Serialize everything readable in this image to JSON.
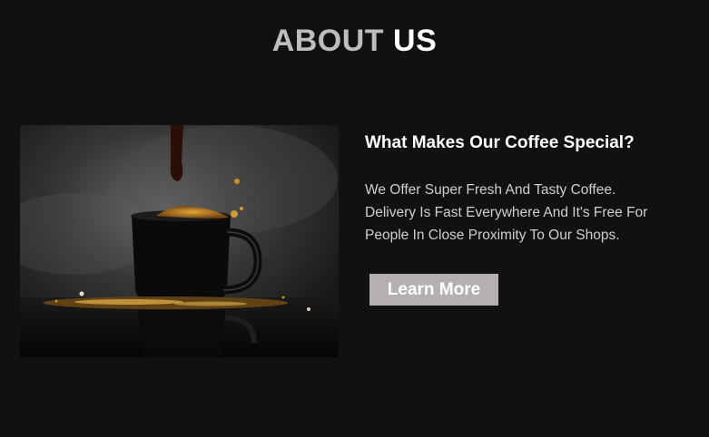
{
  "section": {
    "title_part1": "ABOUT",
    "title_part2": "US"
  },
  "about": {
    "subtitle": "What Makes Our Coffee Special?",
    "description_lines": [
      "We Offer Super Fresh And Tasty Coffee.",
      "Delivery Is Fast Everywhere And It's Free For",
      "People In Close Proximity To Our Shops."
    ],
    "cta_label": "Learn More"
  },
  "colors": {
    "background": "#111111",
    "title_muted": "#bdbdbd",
    "title_bright": "#ffffff",
    "button_bg": "#b5b0b0",
    "coffee_accent": "#c8902a"
  },
  "image": {
    "subject": "coffee-cup-splash-photo"
  }
}
